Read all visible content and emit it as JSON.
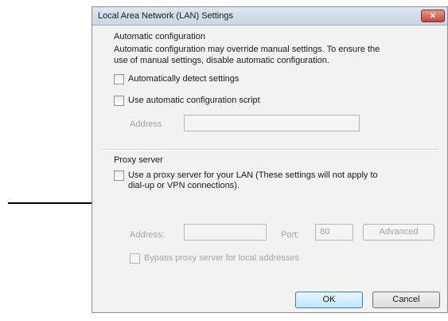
{
  "window": {
    "title": "Local Area Network (LAN) Settings",
    "close_glyph": "✕"
  },
  "automatic_configuration": {
    "group_title": "Automatic configuration",
    "description_line1": "Automatic configuration may override manual settings.  To ensure the",
    "description_line2": "use of manual settings, disable automatic configuration.",
    "detect_label": "Automatically detect settings",
    "script_label": "Use automatic configuration script",
    "address_label": "Address",
    "address_value": ""
  },
  "proxy_server": {
    "group_title": "Proxy server",
    "use_proxy_line1": "Use a proxy server for your LAN (These settings will not apply to",
    "use_proxy_line2": "dial-up or VPN connections).",
    "address_label": "Address:",
    "address_value": "",
    "port_label": "Port:",
    "port_value": "80",
    "advanced_label": "Advanced",
    "bypass_label": "Bypass proxy server for local addresses"
  },
  "buttons": {
    "ok_label": "OK",
    "cancel_label": "Cancel"
  },
  "icons": {
    "arrow": "arrow-right-icon",
    "close": "close-icon"
  }
}
